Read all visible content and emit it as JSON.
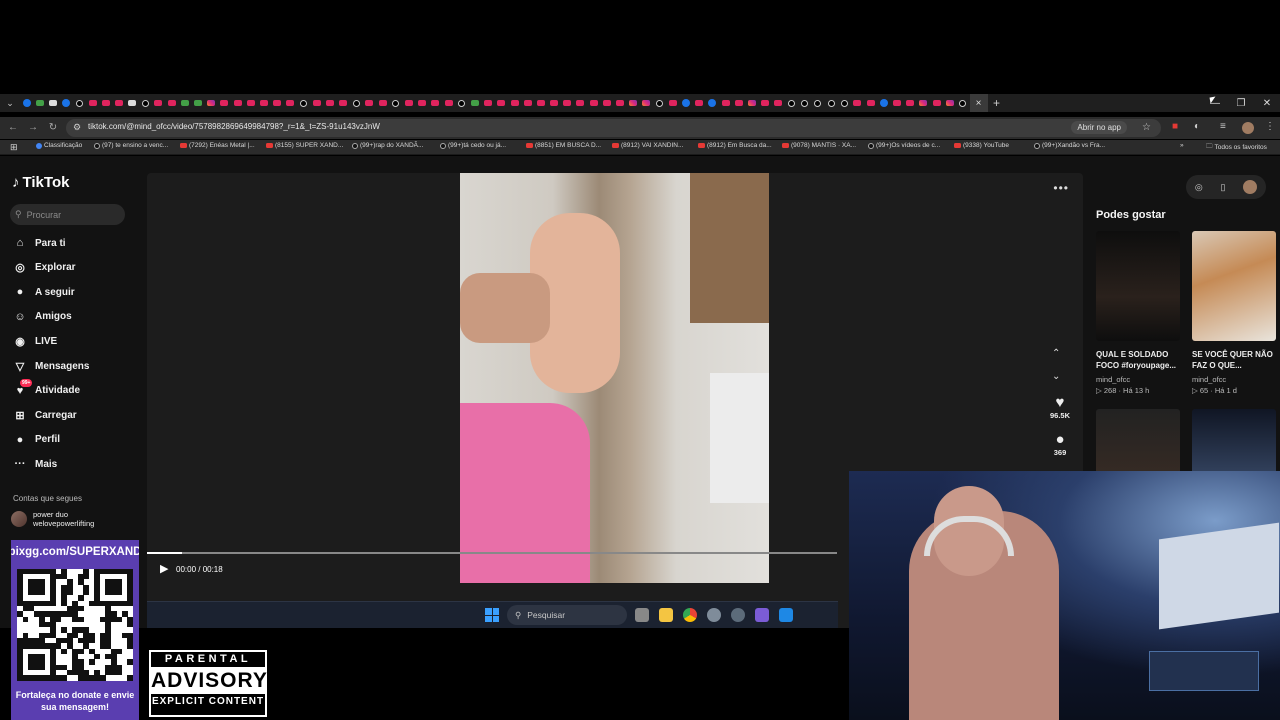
{
  "browser": {
    "url": "tiktok.com/@mind_ofcc/video/7578982869649984798?_r=1&_t=ZS-91u143vzJnW",
    "open_app": "Abrir no app",
    "active_tab_close": "×",
    "new_tab": "+",
    "favorites_label": "Todos os favoritos",
    "bookmarks": [
      {
        "icon": "chrome-icon",
        "label": "Classificação"
      },
      {
        "icon": "tiktok-icon",
        "label": "(97) te ensino a venc..."
      },
      {
        "icon": "youtube-icon",
        "label": "(7292) Enéas Metal |..."
      },
      {
        "icon": "youtube-icon",
        "label": "(8155) SUPER XAND..."
      },
      {
        "icon": "tiktok-icon",
        "label": "(99+)rap do XANDÃ..."
      },
      {
        "icon": "tiktok-icon",
        "label": "(99+)tá cedo ou já..."
      },
      {
        "icon": "youtube-icon",
        "label": "(8851) EM BUSCA D..."
      },
      {
        "icon": "youtube-icon",
        "label": "(8912) VAI XANDIN..."
      },
      {
        "icon": "youtube-icon",
        "label": "(8912) Em Busca da..."
      },
      {
        "icon": "youtube-icon",
        "label": "(9078) MANTIS · XA..."
      },
      {
        "icon": "tiktok-icon",
        "label": "(99+)Os vídeos de c..."
      },
      {
        "icon": "youtube-icon",
        "label": "(9338) YouTube"
      },
      {
        "icon": "tiktok-icon",
        "label": "(99+)Xandão vs Fra..."
      }
    ]
  },
  "tiktok": {
    "brand": "TikTok",
    "search_placeholder": "Procurar",
    "nav": [
      {
        "label": "Para ti",
        "icon": "home-icon"
      },
      {
        "label": "Explorar",
        "icon": "compass-icon"
      },
      {
        "label": "A seguir",
        "icon": "following-icon"
      },
      {
        "label": "Amigos",
        "icon": "friends-icon"
      },
      {
        "label": "LIVE",
        "icon": "live-icon"
      },
      {
        "label": "Mensagens",
        "icon": "messages-icon"
      },
      {
        "label": "Atividade",
        "icon": "activity-icon",
        "badge": "99+"
      },
      {
        "label": "Carregar",
        "icon": "upload-icon"
      },
      {
        "label": "Perfil",
        "icon": "profile-icon"
      },
      {
        "label": "Mais",
        "icon": "more-icon"
      }
    ],
    "following_title": "Contas que segues",
    "following_account": {
      "name": "power duo",
      "handle": "welovepowerlifting"
    },
    "video": {
      "likes": "96.5K",
      "comments": "369",
      "time": "00:00 / 00:18",
      "progress": 0.05
    },
    "recommended_title": "Podes gostar",
    "recommended": [
      {
        "title": "QUAL E SOLDADO FOCO #foryoupage...",
        "user": "mind_ofcc",
        "views": "268",
        "age": "Há 13 h"
      },
      {
        "title": "SE VOCÊ QUER NÃO FAZ O QUE...",
        "user": "mind_ofcc",
        "views": "65",
        "age": "Há 1 d"
      }
    ]
  },
  "taskbar": {
    "search_placeholder": "Pesquisar"
  },
  "overlay": {
    "donate_url": "pixgg.com/SUPERXAND",
    "donate_message": "Fortaleça no donate e envie sua mensagem!",
    "advisory_top": "PARENTAL",
    "advisory_mid": "ADVISORY",
    "advisory_bottom": "EXPLICIT CONTENT"
  }
}
